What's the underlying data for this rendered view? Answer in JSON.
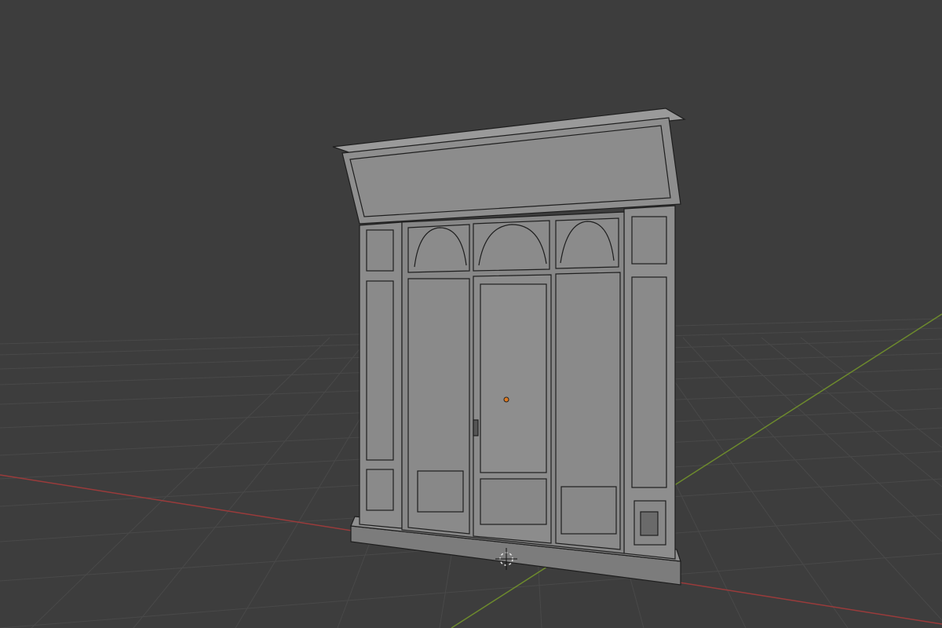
{
  "viewport": {
    "background": "#3d3d3d",
    "grid_color": "#4a4a4a",
    "x_axis_color": "#9a3b3b",
    "y_axis_color": "#6d8a2d"
  },
  "object": {
    "type": "storefront-door-mesh",
    "shading": "solid-wireframe",
    "body_color": "#8a8a8a",
    "edge_color": "#1e1e1e",
    "origin_color": "#e07a1f"
  },
  "icons": {
    "origin": "object-origin-dot-icon",
    "cursor": "3d-cursor-icon"
  }
}
